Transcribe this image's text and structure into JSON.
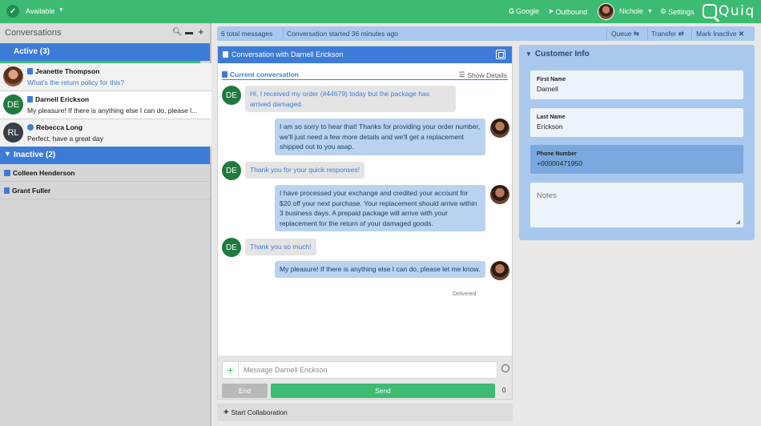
{
  "topbar": {
    "status": "Available",
    "links": [
      {
        "icon": "google-g-icon",
        "glyph": "G",
        "label": "Google"
      },
      {
        "icon": "paper-plane-icon",
        "glyph": "➤",
        "label": "Outbound"
      }
    ],
    "user": "Nichole",
    "settings": "Settings",
    "logo": "Quiq",
    "colors": {
      "bar": "#3dbb72",
      "accent": "#3d7bd9"
    }
  },
  "sidebar": {
    "title": "Conversations",
    "icons": [
      "search-icon",
      "archive-icon",
      "plus-icon"
    ],
    "active_group": "Active (3)",
    "active": [
      {
        "name": "Jeanette Thompson",
        "message": "What's the return policy for this?",
        "avatar": "photo",
        "initials": "",
        "channel": "sms"
      },
      {
        "name": "Darnell Erickson",
        "message": "My pleasure! If there is anything else I can do, please l...",
        "avatar": "initials",
        "initials": "DE",
        "channel": "sms"
      },
      {
        "name": "Rebecca Long",
        "message": "Perfect, have a great day",
        "avatar": "initials",
        "initials": "RL",
        "channel": "web"
      }
    ],
    "inactive_group": "Inactive (2)",
    "inactive": [
      {
        "name": "Colleen Henderson",
        "channel": "web"
      },
      {
        "name": "Grant Fuller",
        "channel": "sms"
      }
    ]
  },
  "summary": {
    "total": "6 total messages",
    "started": "Conversation started 36 minutes ago",
    "queue": "Queue",
    "transfer": "Transfer",
    "mark_inactive": "Mark Inactive"
  },
  "chat": {
    "title": "Conversation with Darnell Erickson",
    "current": "Current conversation",
    "show_details": "Show Details",
    "customer_initials": "DE",
    "messages": [
      {
        "from": "customer",
        "text": "Hi, I received my order (#44679) today but the package has arrived damaged."
      },
      {
        "from": "agent",
        "text": "I am so sorry to hear that! Thanks for providing your order number, we'll just need a few more details and we'll get a replacement shipped out to you asap."
      },
      {
        "from": "customer",
        "text": "Thank you for your quick responses!"
      },
      {
        "from": "agent",
        "text": "I have processed your exchange and credited your account for $20 off your next purchase. Your replacement should arrive within 3 business days. A prepaid package will arrive with your replacement for the return of your damaged goods."
      },
      {
        "from": "customer",
        "text": "Thank you so much!"
      },
      {
        "from": "agent",
        "text": "My pleasure! If there is anything else I can do, please let me know."
      }
    ],
    "delivered": "Delivered",
    "input_placeholder": "Message Darnell Erickson",
    "end": "End",
    "send": "Send",
    "char_count": "0",
    "collab": "Start Collaboration"
  },
  "customer_info": {
    "title": "Customer Info",
    "fields": [
      {
        "label": "First Name",
        "value": "Darnell"
      },
      {
        "label": "Last Name",
        "value": "Erickson"
      },
      {
        "label": "Phone Number",
        "value": "+00000471950"
      }
    ],
    "notes_placeholder": "Notes"
  }
}
